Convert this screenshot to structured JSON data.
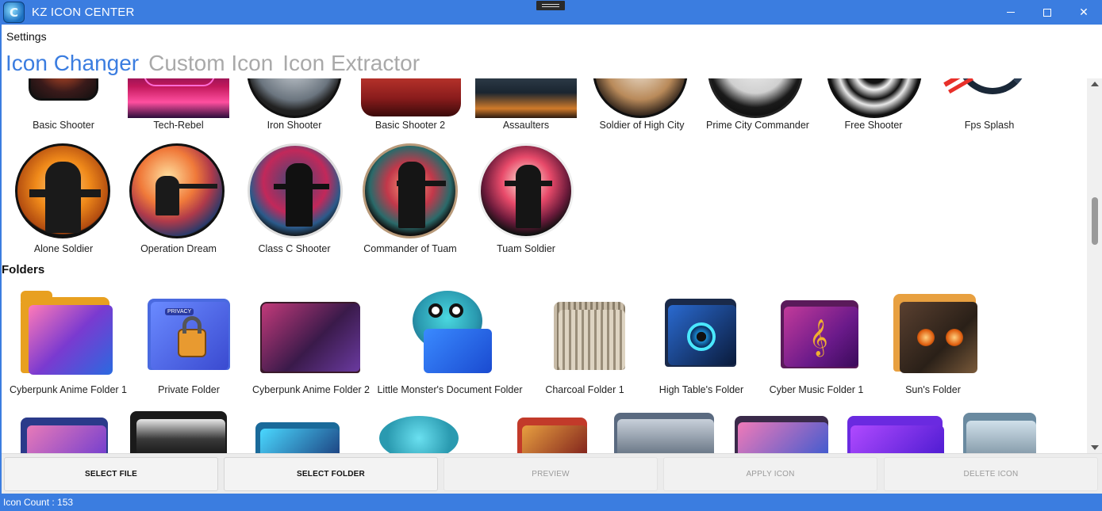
{
  "window": {
    "title": "KZ ICON CENTER",
    "logo_glyph": "C",
    "minimize_icon": "minimize-icon",
    "maximize_icon": "maximize-icon",
    "close_glyph": "✕"
  },
  "menu": {
    "settings_label": "Settings"
  },
  "tabs": [
    {
      "label": "Icon Changer",
      "active": true
    },
    {
      "label": "Custom Icon",
      "active": false
    },
    {
      "label": "Icon Extractor",
      "active": false
    }
  ],
  "row1_labels": [
    "Basic Shooter",
    "Tech-Rebel",
    "Iron Shooter",
    "Basic Shooter 2",
    "Assaulters",
    "Soldier of High City",
    "Prime City Commander",
    "Free Shooter",
    "Fps Splash"
  ],
  "row2_labels": [
    "Alone Soldier",
    "Operation Dream",
    "Class C Shooter",
    "Commander of Tuam",
    "Tuam Soldier"
  ],
  "folders_section_title": "Folders",
  "folder_labels": [
    "Cyberpunk Anime Folder 1",
    "Private Folder",
    "Cyberpunk Anime Folder 2",
    "Little Monster's Document Folder",
    "Charcoal Folder 1",
    "High Table's Folder",
    "Cyber Music Folder 1",
    "Sun's Folder"
  ],
  "private_folder_badge": "PRIVACY",
  "buttons": {
    "select_file": "SELECT FILE",
    "select_folder": "SELECT FOLDER",
    "preview": "PREVIEW",
    "apply_icon": "APPLY ICON",
    "delete_icon": "DELETE ICON"
  },
  "status": {
    "icon_count": "Icon Count : 153"
  },
  "colors": {
    "accent": "#3b7de0",
    "tab_inactive": "#a9a9a9"
  }
}
